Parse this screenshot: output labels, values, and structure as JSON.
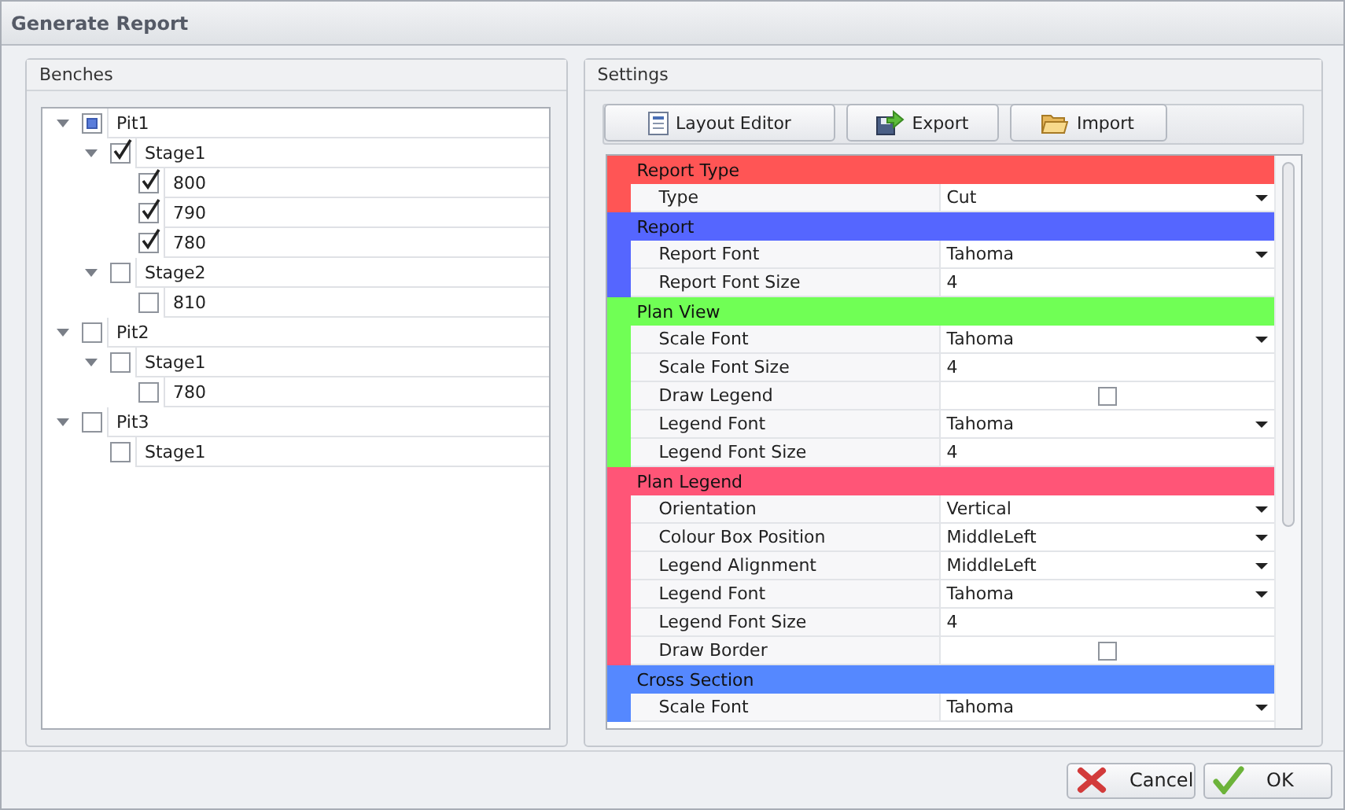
{
  "window": {
    "title": "Generate Report"
  },
  "benches": {
    "title": "Benches",
    "tree": [
      {
        "label": "Pit1",
        "checked": false,
        "partial": true,
        "expanded": true,
        "children": [
          {
            "label": "Stage1",
            "checked": true,
            "partial": false,
            "expanded": true,
            "children": [
              {
                "label": "800",
                "checked": true,
                "partial": false,
                "expanded": false
              },
              {
                "label": "790",
                "checked": true,
                "partial": false,
                "expanded": false
              },
              {
                "label": "780",
                "checked": true,
                "partial": false,
                "expanded": false
              }
            ]
          },
          {
            "label": "Stage2",
            "checked": false,
            "partial": false,
            "expanded": true,
            "children": [
              {
                "label": "810",
                "checked": false,
                "partial": false,
                "expanded": false
              }
            ]
          }
        ]
      },
      {
        "label": "Pit2",
        "checked": false,
        "partial": false,
        "expanded": true,
        "children": [
          {
            "label": "Stage1",
            "checked": false,
            "partial": false,
            "expanded": true,
            "children": [
              {
                "label": "780",
                "checked": false,
                "partial": false,
                "expanded": false
              }
            ]
          }
        ]
      },
      {
        "label": "Pit3",
        "checked": false,
        "partial": false,
        "expanded": true,
        "children": [
          {
            "label": "Stage1",
            "checked": false,
            "partial": false,
            "expanded": false
          }
        ]
      }
    ]
  },
  "settings": {
    "title": "Settings",
    "toolbar": [
      {
        "label": "Layout Editor",
        "kind": "layout"
      },
      {
        "label": "Export",
        "kind": "export"
      },
      {
        "label": "Import",
        "kind": "import"
      }
    ],
    "categories": [
      {
        "name": "Report Type",
        "color": "#ff5555",
        "properties": [
          {
            "name": "Type",
            "kind": "dropdown",
            "value": "Cut"
          }
        ]
      },
      {
        "name": "Report",
        "color": "#5566ff",
        "properties": [
          {
            "name": "Report Font",
            "kind": "dropdown",
            "value": "Tahoma"
          },
          {
            "name": "Report Font Size",
            "kind": "text",
            "value": "4"
          }
        ]
      },
      {
        "name": "Plan View",
        "color": "#70ff55",
        "properties": [
          {
            "name": "Scale Font",
            "kind": "dropdown",
            "value": "Tahoma"
          },
          {
            "name": "Scale Font Size",
            "kind": "text",
            "value": "4"
          },
          {
            "name": "Draw Legend",
            "kind": "checkbox",
            "checked": false
          },
          {
            "name": "Legend Font",
            "kind": "dropdown",
            "value": "Tahoma"
          },
          {
            "name": "Legend Font Size",
            "kind": "text",
            "value": "4"
          }
        ]
      },
      {
        "name": "Plan Legend",
        "color": "#ff5577",
        "properties": [
          {
            "name": "Orientation",
            "kind": "dropdown",
            "value": "Vertical"
          },
          {
            "name": "Colour Box Position",
            "kind": "dropdown",
            "value": "MiddleLeft"
          },
          {
            "name": "Legend Alignment",
            "kind": "dropdown",
            "value": "MiddleLeft"
          },
          {
            "name": "Legend Font",
            "kind": "dropdown",
            "value": "Tahoma"
          },
          {
            "name": "Legend Font Size",
            "kind": "text",
            "value": "4"
          },
          {
            "name": "Draw Border",
            "kind": "checkbox",
            "checked": false
          }
        ]
      },
      {
        "name": "Cross Section",
        "color": "#5588ff",
        "properties": [
          {
            "name": "Scale Font",
            "kind": "dropdown",
            "value": "Tahoma"
          }
        ]
      }
    ]
  },
  "buttons": [
    {
      "label": "Cancel",
      "kind": "cancel"
    },
    {
      "label": "OK",
      "kind": "ok"
    }
  ]
}
